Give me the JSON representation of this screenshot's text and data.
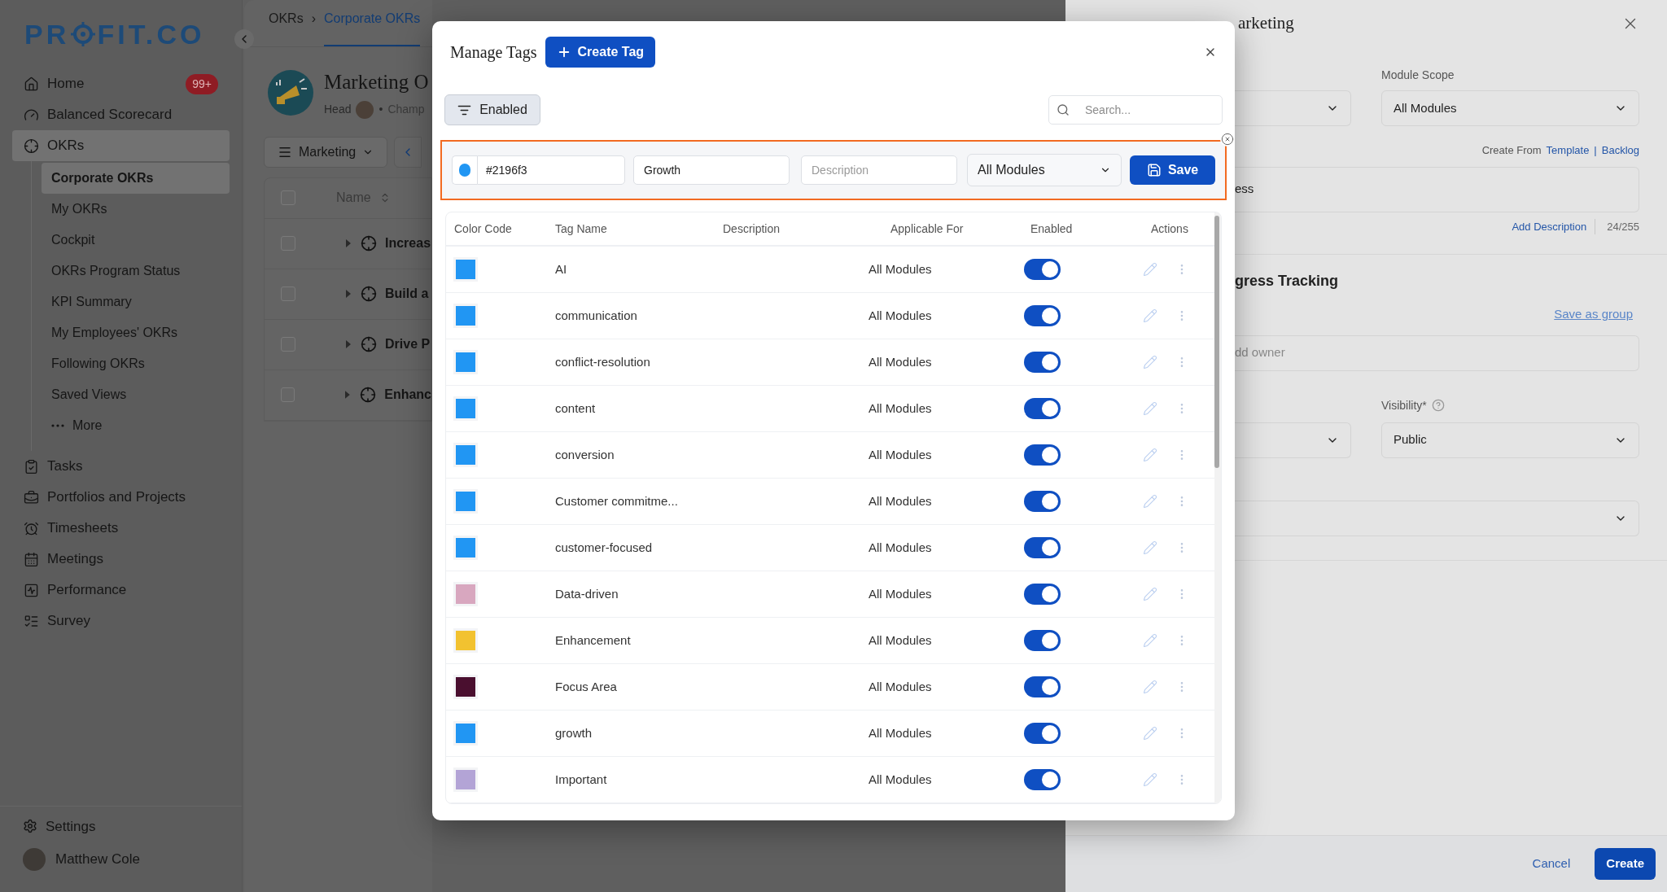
{
  "sidebar": {
    "logo": {
      "before": "PR",
      "after": "FIT.CO"
    },
    "items": [
      {
        "label": "Home",
        "badge": "99+",
        "selected": false
      },
      {
        "label": "Balanced Scorecard",
        "selected": false
      },
      {
        "label": "OKRs",
        "selected": true,
        "children": [
          {
            "label": "Corporate OKRs",
            "selected": true
          },
          {
            "label": "My OKRs",
            "selected": false
          },
          {
            "label": "Cockpit",
            "selected": false
          },
          {
            "label": "OKRs Program Status",
            "selected": false
          },
          {
            "label": "KPI Summary",
            "selected": false
          },
          {
            "label": "My Employees' OKRs",
            "selected": false
          },
          {
            "label": "Following OKRs",
            "selected": false
          },
          {
            "label": "Saved Views",
            "selected": false
          },
          {
            "label": "More",
            "kind": "more",
            "selected": false
          }
        ]
      },
      {
        "label": "Tasks",
        "selected": false
      },
      {
        "label": "Portfolios and Projects",
        "selected": false
      },
      {
        "label": "Timesheets",
        "selected": false
      },
      {
        "label": "Meetings",
        "selected": false
      },
      {
        "label": "Performance",
        "selected": false
      },
      {
        "label": "Survey",
        "selected": false
      }
    ],
    "settings": "Settings",
    "user": "Matthew Cole"
  },
  "main": {
    "breadcrumb": [
      {
        "label": "OKRs",
        "selected": false
      },
      {
        "label": "Corporate OKRs",
        "selected": true
      }
    ],
    "breadcrumb_separator": "›",
    "heading": "Marketing O",
    "head_label": "Head",
    "bullet": "•",
    "champ": "Champ",
    "team_button": "Marketing",
    "table": {
      "column": "Name",
      "select_all_checked": false,
      "rows": [
        {
          "name": "Increas",
          "checked": false
        },
        {
          "name": "Build a",
          "checked": false
        },
        {
          "name": "Drive P",
          "checked": false
        },
        {
          "name": "Enhanc",
          "checked": false
        }
      ]
    }
  },
  "modal": {
    "title": "Manage Tags",
    "create_button": "Create Tag",
    "filter": "Enabled",
    "search": {
      "placeholder": "Search..."
    },
    "form": {
      "color": "#2196f3",
      "color_value": "#2196f3",
      "name": "Growth",
      "description_placeholder": "Description",
      "module": "All Modules",
      "save": "Save"
    },
    "columns": [
      "Color Code",
      "Tag Name",
      "Description",
      "Applicable For",
      "Enabled",
      "Actions"
    ],
    "tags": [
      {
        "color": "#2196f3",
        "name": "AI",
        "applicable": "All Modules",
        "enabled": true
      },
      {
        "color": "#2196f3",
        "name": "communication",
        "applicable": "All Modules",
        "enabled": true
      },
      {
        "color": "#2196f3",
        "name": "conflict-resolution",
        "applicable": "All Modules",
        "enabled": true
      },
      {
        "color": "#2196f3",
        "name": "content",
        "applicable": "All Modules",
        "enabled": true
      },
      {
        "color": "#2196f3",
        "name": "conversion",
        "applicable": "All Modules",
        "enabled": true
      },
      {
        "color": "#2196f3",
        "name": "Customer commitme...",
        "applicable": "All Modules",
        "enabled": true
      },
      {
        "color": "#2196f3",
        "name": "customer-focused",
        "applicable": "All Modules",
        "enabled": true
      },
      {
        "color": "#d8a7bf",
        "name": "Data-driven",
        "applicable": "All Modules",
        "enabled": true
      },
      {
        "color": "#f2c230",
        "name": "Enhancement",
        "applicable": "All Modules",
        "enabled": true
      },
      {
        "color": "#4a0f2f",
        "name": "Focus Area",
        "applicable": "All Modules",
        "enabled": true
      },
      {
        "color": "#2196f3",
        "name": "growth",
        "applicable": "All Modules",
        "enabled": true
      },
      {
        "color": "#b3a4d6",
        "name": "Important",
        "applicable": "All Modules",
        "enabled": true
      }
    ]
  },
  "drawer": {
    "title": "arketing",
    "module_scope": {
      "label": "Module Scope",
      "value": "All Modules"
    },
    "create_from": "Create From",
    "template_link": "Template",
    "pipe": "|",
    "backlog_link": "Backlog",
    "objective_value": "ess",
    "add_description": "Add Description",
    "char_count": "24/255",
    "section_title": "gress Tracking",
    "save_group": "Save as group",
    "owner_placeholder": "dd owner",
    "visibility": {
      "label": "Visibility*",
      "value": "Public"
    },
    "cancel": "Cancel",
    "create": "Create"
  }
}
